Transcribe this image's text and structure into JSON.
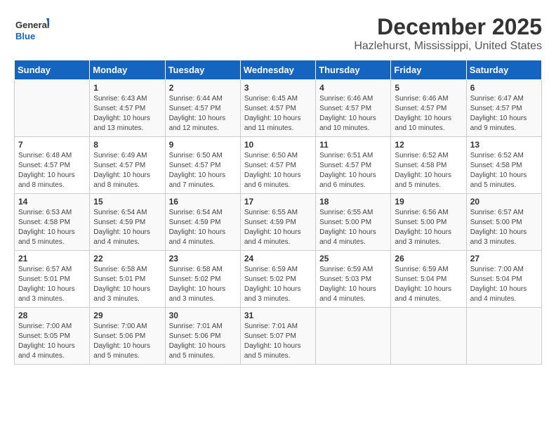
{
  "header": {
    "logo_line1": "General",
    "logo_line2": "Blue",
    "month": "December 2025",
    "location": "Hazlehurst, Mississippi, United States"
  },
  "days_of_week": [
    "Sunday",
    "Monday",
    "Tuesday",
    "Wednesday",
    "Thursday",
    "Friday",
    "Saturday"
  ],
  "weeks": [
    [
      {
        "day": "",
        "info": ""
      },
      {
        "day": "1",
        "info": "Sunrise: 6:43 AM\nSunset: 4:57 PM\nDaylight: 10 hours\nand 13 minutes."
      },
      {
        "day": "2",
        "info": "Sunrise: 6:44 AM\nSunset: 4:57 PM\nDaylight: 10 hours\nand 12 minutes."
      },
      {
        "day": "3",
        "info": "Sunrise: 6:45 AM\nSunset: 4:57 PM\nDaylight: 10 hours\nand 11 minutes."
      },
      {
        "day": "4",
        "info": "Sunrise: 6:46 AM\nSunset: 4:57 PM\nDaylight: 10 hours\nand 10 minutes."
      },
      {
        "day": "5",
        "info": "Sunrise: 6:46 AM\nSunset: 4:57 PM\nDaylight: 10 hours\nand 10 minutes."
      },
      {
        "day": "6",
        "info": "Sunrise: 6:47 AM\nSunset: 4:57 PM\nDaylight: 10 hours\nand 9 minutes."
      }
    ],
    [
      {
        "day": "7",
        "info": "Sunrise: 6:48 AM\nSunset: 4:57 PM\nDaylight: 10 hours\nand 8 minutes."
      },
      {
        "day": "8",
        "info": "Sunrise: 6:49 AM\nSunset: 4:57 PM\nDaylight: 10 hours\nand 8 minutes."
      },
      {
        "day": "9",
        "info": "Sunrise: 6:50 AM\nSunset: 4:57 PM\nDaylight: 10 hours\nand 7 minutes."
      },
      {
        "day": "10",
        "info": "Sunrise: 6:50 AM\nSunset: 4:57 PM\nDaylight: 10 hours\nand 6 minutes."
      },
      {
        "day": "11",
        "info": "Sunrise: 6:51 AM\nSunset: 4:57 PM\nDaylight: 10 hours\nand 6 minutes."
      },
      {
        "day": "12",
        "info": "Sunrise: 6:52 AM\nSunset: 4:58 PM\nDaylight: 10 hours\nand 5 minutes."
      },
      {
        "day": "13",
        "info": "Sunrise: 6:52 AM\nSunset: 4:58 PM\nDaylight: 10 hours\nand 5 minutes."
      }
    ],
    [
      {
        "day": "14",
        "info": "Sunrise: 6:53 AM\nSunset: 4:58 PM\nDaylight: 10 hours\nand 5 minutes."
      },
      {
        "day": "15",
        "info": "Sunrise: 6:54 AM\nSunset: 4:59 PM\nDaylight: 10 hours\nand 4 minutes."
      },
      {
        "day": "16",
        "info": "Sunrise: 6:54 AM\nSunset: 4:59 PM\nDaylight: 10 hours\nand 4 minutes."
      },
      {
        "day": "17",
        "info": "Sunrise: 6:55 AM\nSunset: 4:59 PM\nDaylight: 10 hours\nand 4 minutes."
      },
      {
        "day": "18",
        "info": "Sunrise: 6:55 AM\nSunset: 5:00 PM\nDaylight: 10 hours\nand 4 minutes."
      },
      {
        "day": "19",
        "info": "Sunrise: 6:56 AM\nSunset: 5:00 PM\nDaylight: 10 hours\nand 3 minutes."
      },
      {
        "day": "20",
        "info": "Sunrise: 6:57 AM\nSunset: 5:00 PM\nDaylight: 10 hours\nand 3 minutes."
      }
    ],
    [
      {
        "day": "21",
        "info": "Sunrise: 6:57 AM\nSunset: 5:01 PM\nDaylight: 10 hours\nand 3 minutes."
      },
      {
        "day": "22",
        "info": "Sunrise: 6:58 AM\nSunset: 5:01 PM\nDaylight: 10 hours\nand 3 minutes."
      },
      {
        "day": "23",
        "info": "Sunrise: 6:58 AM\nSunset: 5:02 PM\nDaylight: 10 hours\nand 3 minutes."
      },
      {
        "day": "24",
        "info": "Sunrise: 6:59 AM\nSunset: 5:02 PM\nDaylight: 10 hours\nand 3 minutes."
      },
      {
        "day": "25",
        "info": "Sunrise: 6:59 AM\nSunset: 5:03 PM\nDaylight: 10 hours\nand 4 minutes."
      },
      {
        "day": "26",
        "info": "Sunrise: 6:59 AM\nSunset: 5:04 PM\nDaylight: 10 hours\nand 4 minutes."
      },
      {
        "day": "27",
        "info": "Sunrise: 7:00 AM\nSunset: 5:04 PM\nDaylight: 10 hours\nand 4 minutes."
      }
    ],
    [
      {
        "day": "28",
        "info": "Sunrise: 7:00 AM\nSunset: 5:05 PM\nDaylight: 10 hours\nand 4 minutes."
      },
      {
        "day": "29",
        "info": "Sunrise: 7:00 AM\nSunset: 5:06 PM\nDaylight: 10 hours\nand 5 minutes."
      },
      {
        "day": "30",
        "info": "Sunrise: 7:01 AM\nSunset: 5:06 PM\nDaylight: 10 hours\nand 5 minutes."
      },
      {
        "day": "31",
        "info": "Sunrise: 7:01 AM\nSunset: 5:07 PM\nDaylight: 10 hours\nand 5 minutes."
      },
      {
        "day": "",
        "info": ""
      },
      {
        "day": "",
        "info": ""
      },
      {
        "day": "",
        "info": ""
      }
    ]
  ]
}
